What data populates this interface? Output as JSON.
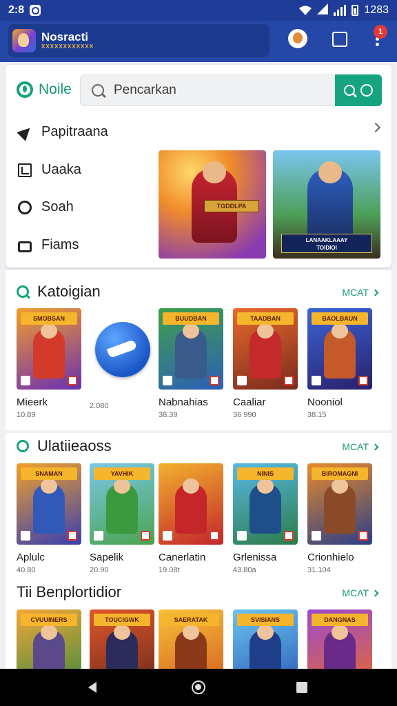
{
  "status": {
    "time": "2:8",
    "clock_right": "1283"
  },
  "appbar": {
    "title": "Nosracti",
    "subtitle": "XXXXXXXXXXXX",
    "menu_badge": "1"
  },
  "header": {
    "brand": "Noile",
    "search_placeholder": "Pencarkan"
  },
  "nav": [
    {
      "label": "Papitraana",
      "icon": "arrow-icon"
    },
    {
      "label": "Uaaka",
      "icon": "box-icon"
    },
    {
      "label": "Soah",
      "icon": "circle-icon"
    },
    {
      "label": "Fiams",
      "icon": "bag-icon"
    }
  ],
  "banners": [
    {
      "caption": "TGDDLPA"
    },
    {
      "caption": "LANAAKLAAAY\nTOIDIOI"
    }
  ],
  "sections": [
    {
      "title": "Katoigian",
      "more": "MCAT",
      "games": [
        {
          "name": "Mieerk",
          "meta": "10.89",
          "tag": "SMOBSAN",
          "colors": [
            "#f39c2a",
            "#6b2fb3"
          ],
          "hero": "#d43a2a"
        },
        {
          "name": "",
          "meta": "2.080",
          "tag": "",
          "special": true
        },
        {
          "name": "Nabnahias",
          "meta": "38.39",
          "tag": "BUUDBAN",
          "colors": [
            "#3fa04a",
            "#2c5fb8"
          ],
          "hero": "#3b5a8c"
        },
        {
          "name": "Caaliar",
          "meta": "36 990",
          "tag": "TAADBAN",
          "colors": [
            "#e86a2c",
            "#7a2b1e"
          ],
          "hero": "#c42a2a"
        },
        {
          "name": "Nooniol",
          "meta": "38.15",
          "tag": "BAOLBAUN",
          "colors": [
            "#3a66d6",
            "#2a1f6b"
          ],
          "hero": "#c45a2a"
        }
      ]
    },
    {
      "title": "Ulatiieaoss",
      "more": "MCAT",
      "games": [
        {
          "name": "Aplulc",
          "meta": "40.80",
          "tag": "SNAMAN",
          "colors": [
            "#f0a02a",
            "#3a3fb0"
          ],
          "hero": "#3359b8"
        },
        {
          "name": "Sapelik",
          "meta": "20.90",
          "tag": "YAVHIK",
          "colors": [
            "#7cc7e8",
            "#4aa34d"
          ],
          "hero": "#3b9a3e"
        },
        {
          "name": "Canerlatin",
          "meta": "19.08t",
          "tag": "",
          "colors": [
            "#f2b12e",
            "#c2262a"
          ],
          "hero": "#c4262a"
        },
        {
          "name": "Grlenissa",
          "meta": "43.80a",
          "tag": "NINIS",
          "colors": [
            "#58b9e6",
            "#2c7c47"
          ],
          "hero": "#1f4f8a"
        },
        {
          "name": "Crionhielo",
          "meta": "31.104",
          "tag": "BIROMAGNI",
          "colors": [
            "#e88a2a",
            "#2b3f8a"
          ],
          "hero": "#8a4a2a"
        }
      ]
    },
    {
      "title": "Tii Benplortidior",
      "more": "MCAT",
      "games": [
        {
          "name": "",
          "meta": "",
          "tag": "CVUUINERS",
          "colors": [
            "#f3a63a",
            "#3a8a3a"
          ],
          "hero": "#5a4a8a"
        },
        {
          "name": "",
          "meta": "",
          "tag": "TOUCIGWK",
          "colors": [
            "#e0562a",
            "#6a2a1a"
          ],
          "hero": "#2c2c5a"
        },
        {
          "name": "",
          "meta": "",
          "tag": "SAERATAK",
          "colors": [
            "#f7c23a",
            "#d45a1e"
          ],
          "hero": "#8a3a1a"
        },
        {
          "name": "",
          "meta": "",
          "tag": "SVISIANS",
          "colors": [
            "#6ac4f0",
            "#2a5ab8"
          ],
          "hero": "#1f3f8a"
        },
        {
          "name": "",
          "meta": "",
          "tag": "DANGNAS",
          "colors": [
            "#9a4ad0",
            "#e86a2a"
          ],
          "hero": "#6a2a8a"
        }
      ]
    }
  ]
}
